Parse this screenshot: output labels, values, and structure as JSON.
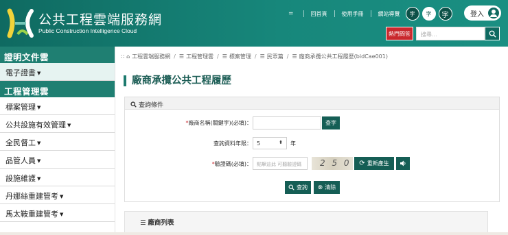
{
  "header": {
    "site_title": "公共工程雲端服務網",
    "site_subtitle": "Public Construction Intelligence Cloud",
    "menu_mini": "=",
    "nav": [
      "回首頁",
      "使用手冊",
      "網站導覽"
    ],
    "font_sizes": [
      "字",
      "字",
      "字"
    ],
    "login_label": "登入",
    "hot_qa_label": "熱門問答",
    "search_placeholder": "搜尋..."
  },
  "sidebar": {
    "sections": [
      {
        "title": "證明文件雲",
        "items": [
          "電子證書"
        ]
      },
      {
        "title": "工程管理雲",
        "items": [
          "標案管理",
          "公共設施有效管理",
          "全民督工",
          "品管人員",
          "設施維護",
          "丹娜絲重建管考",
          "馬太鞍重建管考"
        ]
      }
    ]
  },
  "breadcrumb": [
    "工程雲端服務網",
    "工程管理雲",
    "標案管理",
    "民眾篇",
    "廠商承攬公共工程履歷(bidCae001)"
  ],
  "page_title": "廠商承攬公共工程履歷",
  "query": {
    "panel_title": "查詢條件",
    "vendor_label": "廠商名稱(關鍵字)(必填)：",
    "vendor_value": "",
    "query_btn": "查字",
    "years_label": "查詢資料年限：",
    "years_value": "5",
    "years_unit": "年",
    "captcha_label": "驗證碼(必填)：",
    "captcha_placeholder": "點擊這此 可聽驗證碼",
    "captcha_text": "2 5 0",
    "regen_btn": "重新產生",
    "submit_btn": "查詢",
    "clear_btn": "清除"
  },
  "list": {
    "title": "廠商列表"
  },
  "colors": {
    "brand": "#0f6a61",
    "sidebar_header": "#1f7f72",
    "hot": "#c9282d",
    "button": "#155e55"
  }
}
